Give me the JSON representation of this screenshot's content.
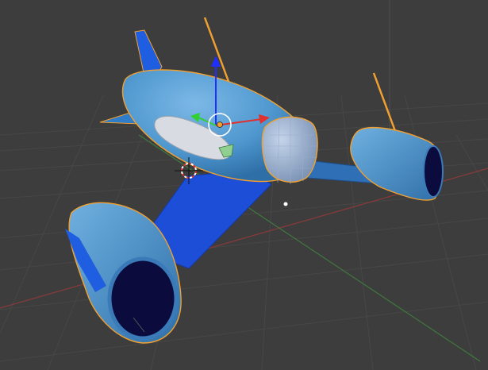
{
  "viewport": {
    "background": "#3d3d3d",
    "grid_color": "#474747",
    "x_axis_color": "#8a3a3a",
    "y_axis_color": "#3f7a3f"
  },
  "model": {
    "body_color": "#4f98cf",
    "body_dark_color": "#2f6fa8",
    "fin_color": "#1f5ee0",
    "wing_color": "#1d4ed8",
    "intake_color": "#0b0b3e",
    "canopy_color": "#8fa8c8",
    "selection_outline_color": "#f0a030"
  },
  "gizmo": {
    "x_axis_color": "#e03030",
    "y_axis_color": "#2fd02f",
    "z_axis_color": "#1e2fff",
    "origin_color": "#f0a030"
  },
  "icons": {
    "cursor": "3d-cursor-icon",
    "origin": "object-origin-icon"
  }
}
